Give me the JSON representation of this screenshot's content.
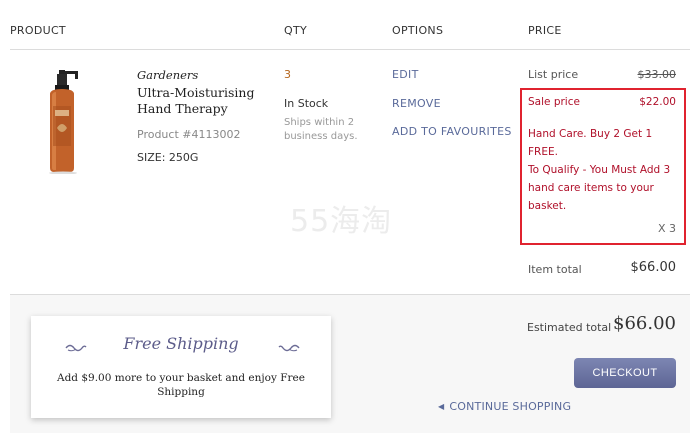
{
  "headers": {
    "product": "PRODUCT",
    "qty": "QTY",
    "options": "OPTIONS",
    "price": "PRICE"
  },
  "item": {
    "brand": "Gardeners",
    "name": "Ultra-Moisturising Hand Therapy",
    "product_number": "Product #4113002",
    "size": "SIZE: 250G",
    "qty": "3",
    "stock": "In Stock",
    "ships": "Ships within 2 business days.",
    "options": {
      "edit": "EDIT",
      "remove": "REMOVE",
      "favourites": "ADD TO FAVOURITES"
    },
    "list_label": "List price",
    "list_price": "$33.00",
    "sale_label": "Sale price",
    "sale_price": "$22.00",
    "promo_line1": "Hand Care. Buy 2 Get 1 FREE.",
    "promo_line2": "To Qualify - You Must Add 3 hand care items to your basket.",
    "times": "X 3",
    "item_total_label": "Item total",
    "item_total": "$66.00"
  },
  "watermark": "55海淘",
  "shipping": {
    "title": "Free Shipping",
    "text": "Add $9.00 more to your basket and enjoy Free Shipping"
  },
  "summary": {
    "est_label": "Estimated total",
    "est_value": "$66.00",
    "checkout": "CHECKOUT",
    "continue": "CONTINUE SHOPPING"
  },
  "colors": {
    "accent": "#5a6a9a",
    "sale": "#b0102a",
    "highlight_border": "#e0232f",
    "checkout_button": "#6a72a4"
  }
}
